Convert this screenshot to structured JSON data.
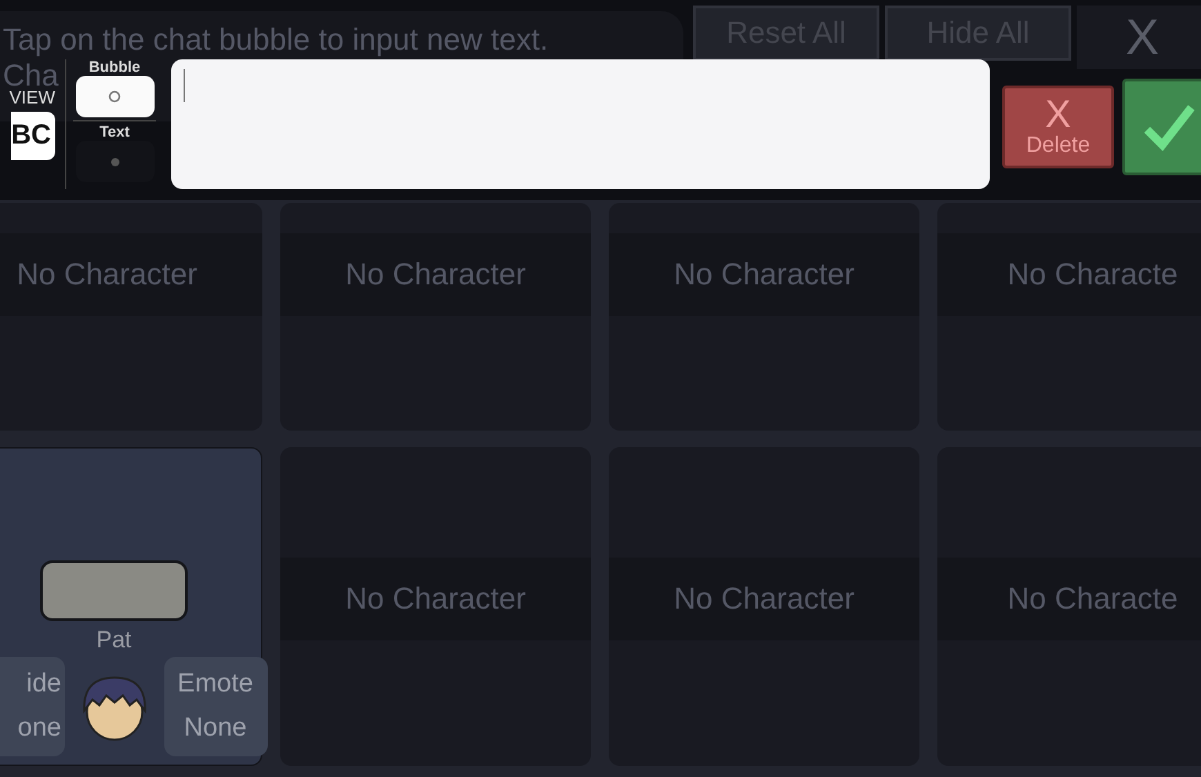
{
  "hint": {
    "lines": [
      "Tap on the chat bubble to input new text.",
      "Cha"
    ]
  },
  "top_buttons": [
    {
      "kind": "text",
      "label": "Reset All"
    },
    {
      "kind": "text",
      "label": "Hide All"
    },
    {
      "kind": "close",
      "label": "X"
    }
  ],
  "preview": {
    "label": "VIEW",
    "sample": "BC"
  },
  "style_toggle": [
    {
      "label": "Bubble",
      "selected": true
    },
    {
      "label": "Text",
      "selected": false
    }
  ],
  "delete_button": {
    "icon": "X",
    "label": "Delete"
  },
  "slots": [
    {
      "kind": "empty",
      "label": "No Character",
      "selected": false
    },
    {
      "kind": "empty",
      "label": "No Character",
      "selected": false
    },
    {
      "kind": "empty",
      "label": "No Character",
      "selected": false
    },
    {
      "kind": "empty",
      "label": "No Characte",
      "selected": false
    },
    {
      "kind": "character",
      "name": "Pat",
      "selected": true,
      "options": [
        {
          "label": "ide",
          "value": "one"
        },
        {
          "label": "Emote",
          "value": "None"
        }
      ]
    },
    {
      "kind": "empty",
      "label": "No Character",
      "selected": false
    },
    {
      "kind": "empty",
      "label": "No Character",
      "selected": false
    },
    {
      "kind": "empty",
      "label": "No Characte",
      "selected": false
    }
  ]
}
